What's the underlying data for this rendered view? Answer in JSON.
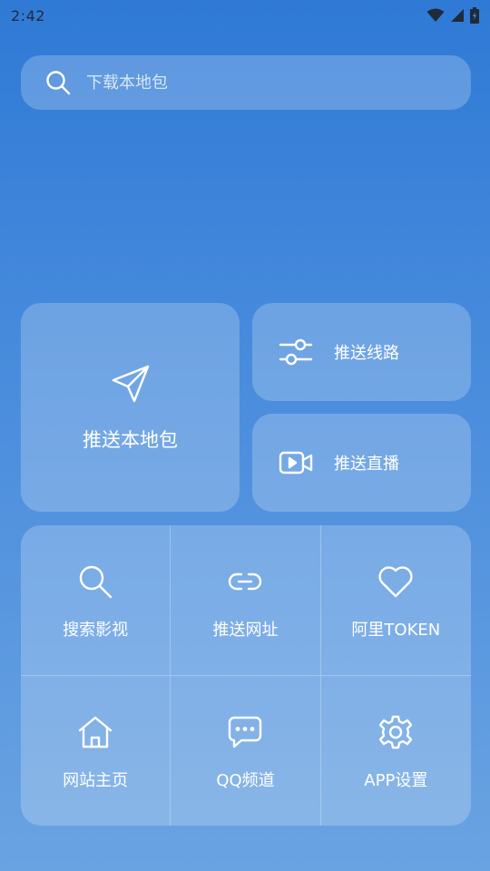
{
  "status_bar": {
    "time": "2:42"
  },
  "search": {
    "placeholder": "下载本地包"
  },
  "cards": {
    "push_local": {
      "label": "推送本地包",
      "icon": "send-icon"
    },
    "push_route": {
      "label": "推送线路",
      "icon": "sliders-icon"
    },
    "push_live": {
      "label": "推送直播",
      "icon": "video-icon"
    }
  },
  "grid": [
    {
      "label": "搜索影视",
      "icon": "search-icon"
    },
    {
      "label": "推送网址",
      "icon": "link-icon"
    },
    {
      "label": "阿里TOKEN",
      "icon": "heart-icon"
    },
    {
      "label": "网站主页",
      "icon": "home-icon"
    },
    {
      "label": "QQ频道",
      "icon": "chat-icon"
    },
    {
      "label": "APP设置",
      "icon": "gear-icon"
    }
  ]
}
